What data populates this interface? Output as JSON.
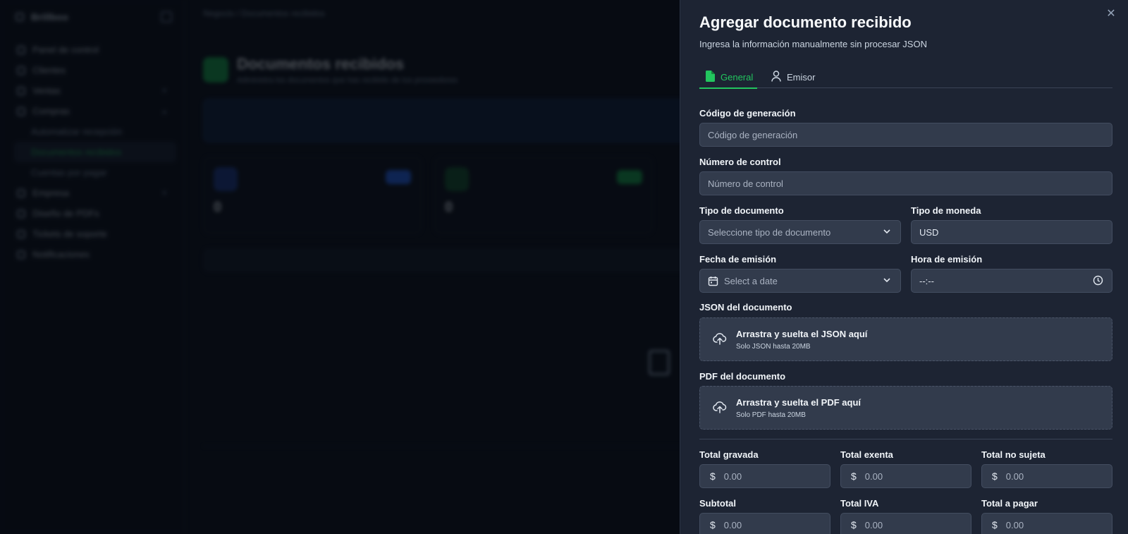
{
  "background": {
    "brand": "Brillboo",
    "breadcrumb": "Negocio / Documentos recibidos",
    "page_title": "Documentos recibidos",
    "page_subtitle": "Administra los documentos que has recibido de tus proveedores",
    "nav": [
      {
        "label": "Panel de control"
      },
      {
        "label": "Clientes"
      },
      {
        "label": "Ventas"
      },
      {
        "label": "Compras"
      },
      {
        "label": "Automatizar recepción"
      },
      {
        "label": "Documentos recibidos"
      },
      {
        "label": "Cuentas por pagar"
      },
      {
        "label": "Empresa"
      },
      {
        "label": "Diseño de PDFs"
      },
      {
        "label": "Tickets de soporte"
      },
      {
        "label": "Notificaciones"
      }
    ],
    "stat_values": [
      "0",
      "0"
    ]
  },
  "drawer": {
    "title": "Agregar documento recibido",
    "subtitle": "Ingresa la información manualmente sin procesar JSON",
    "close_icon": "close-icon",
    "tabs": [
      {
        "label": "General",
        "icon": "file-icon",
        "active": true
      },
      {
        "label": "Emisor",
        "icon": "user-icon",
        "active": false
      }
    ],
    "fields": {
      "codigo": {
        "label": "Código de generación",
        "placeholder": "Código de generación"
      },
      "numero": {
        "label": "Número de control",
        "placeholder": "Número de control"
      },
      "tipo_doc": {
        "label": "Tipo de documento",
        "placeholder": "Seleccione tipo de documento"
      },
      "moneda": {
        "label": "Tipo de moneda",
        "value": "USD"
      },
      "fecha": {
        "label": "Fecha de emisión",
        "placeholder": "Select a date"
      },
      "hora": {
        "label": "Hora de emisión",
        "placeholder": "--:--"
      }
    },
    "json_upload": {
      "label": "JSON del documento",
      "title": "Arrastra y suelta el JSON aquí",
      "hint": "Solo JSON hasta 20MB"
    },
    "pdf_upload": {
      "label": "PDF del documento",
      "title": "Arrastra y suelta el PDF aquí",
      "hint": "Solo PDF hasta 20MB"
    },
    "totals": [
      {
        "label": "Total gravada",
        "placeholder": "0.00"
      },
      {
        "label": "Total exenta",
        "placeholder": "0.00"
      },
      {
        "label": "Total no sujeta",
        "placeholder": "0.00"
      },
      {
        "label": "Subtotal",
        "placeholder": "0.00"
      },
      {
        "label": "Total IVA",
        "placeholder": "0.00"
      },
      {
        "label": "Total a pagar",
        "placeholder": "0.00"
      }
    ],
    "currency_symbol": "$"
  },
  "colors": {
    "accent": "#22c55e",
    "drawer_bg": "#1d2433",
    "input_bg": "#323b4c",
    "page_bg": "#0b0f19"
  }
}
